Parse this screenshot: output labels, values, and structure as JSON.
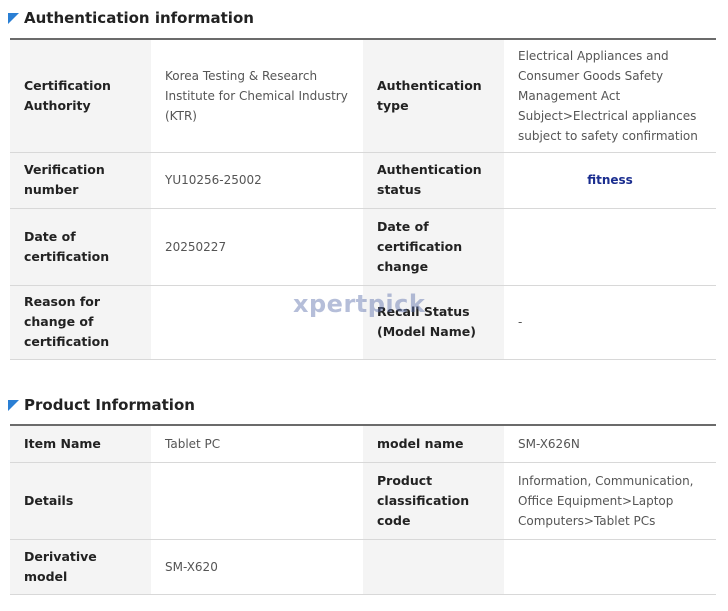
{
  "auth_section": {
    "title": "Authentication information",
    "rows": [
      {
        "label1": "Certification Authority",
        "value1": "Korea Testing & Research Institute for Chemical Industry (KTR)",
        "label2": "Authentication type",
        "value2": "Electrical Appliances and Consumer Goods Safety Management Act Subject>Electrical appliances subject to safety confirmation"
      },
      {
        "label1": "Verification number",
        "value1": "YU10256-25002",
        "label2": "Authentication status",
        "value2": "fitness"
      },
      {
        "label1": "Date of certification",
        "value1": "20250227",
        "label2": "Date of certification change",
        "value2": ""
      },
      {
        "label1": "Reason for change of certification",
        "value1": "",
        "label2": "Recall Status (Model Name)",
        "value2": "-"
      }
    ]
  },
  "product_section": {
    "title": "Product Information",
    "rows": [
      {
        "label1": "Item Name",
        "value1": "Tablet PC",
        "label2": "model name",
        "value2": "SM-X626N"
      },
      {
        "label1": "Details",
        "value1": "",
        "label2": "Product classification code",
        "value2": "Information, Communication, Office Equipment>Laptop Computers>Tablet PCs"
      },
      {
        "label1": "Derivative model",
        "value1": "SM-X620",
        "label2": "",
        "value2": ""
      }
    ]
  },
  "watermark": "xpertpick",
  "colors": {
    "marker": "#2a7fd4",
    "header_border": "#6b6b6b",
    "label_bg": "#f4f4f4",
    "accent": "#1a2d8f"
  },
  "icons": {
    "section_marker": "triangle-corner-icon"
  }
}
